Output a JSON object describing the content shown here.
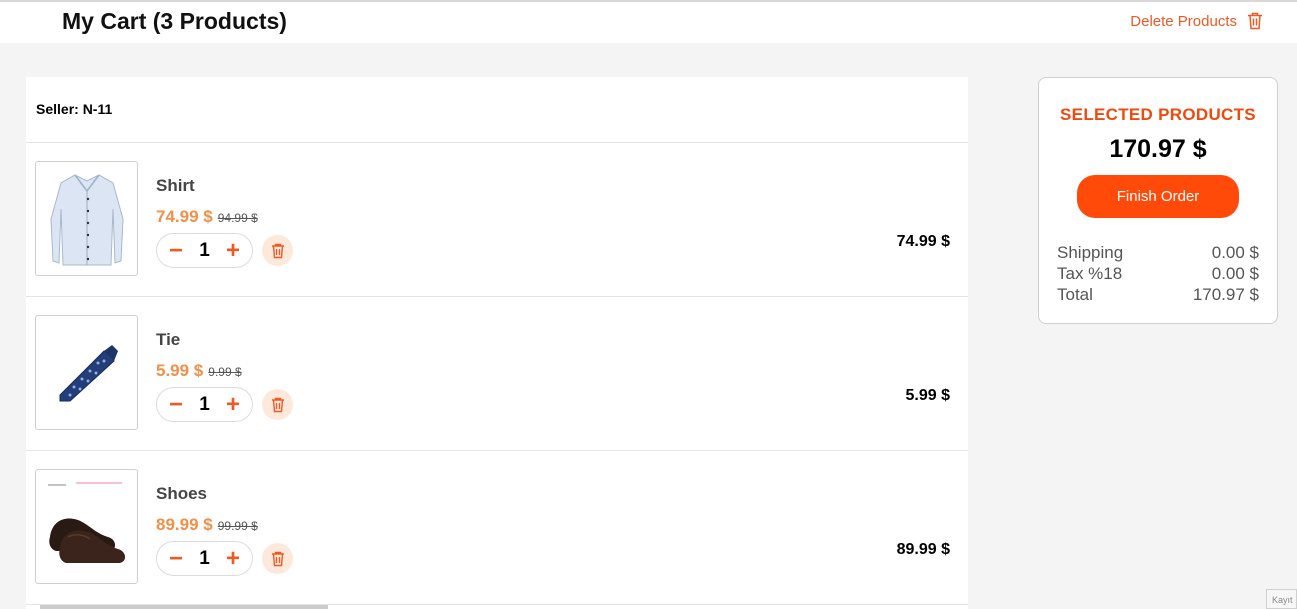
{
  "header": {
    "title": "My Cart (3 Products)",
    "delete_label": "Delete Products"
  },
  "seller": {
    "label": "Seller: N-11"
  },
  "items": [
    {
      "name": "Shirt",
      "price": "74.99 $",
      "old_price": "94.99 $",
      "qty": "1",
      "total": "74.99 $"
    },
    {
      "name": "Tie",
      "price": "5.99 $",
      "old_price": "9.99 $",
      "qty": "1",
      "total": "5.99 $"
    },
    {
      "name": "Shoes",
      "price": "89.99 $",
      "old_price": "99.99 $",
      "qty": "1",
      "total": "89.99 $"
    }
  ],
  "summary": {
    "title": "SELECTED PRODUCTS",
    "amount": "170.97 $",
    "finish_label": "Finish Order",
    "lines": [
      {
        "label": "Shipping",
        "value": "0.00 $"
      },
      {
        "label": "Tax %18",
        "value": "0.00 $"
      },
      {
        "label": "Total",
        "value": "170.97 $"
      }
    ]
  },
  "corner_badge": "Kayıt",
  "colors": {
    "accent": "#ee5a24",
    "button": "#ff4a0a",
    "price": "#f0904a"
  },
  "icons": {
    "delete": "trash-icon",
    "minus": "minus-icon",
    "plus": "plus-icon"
  }
}
